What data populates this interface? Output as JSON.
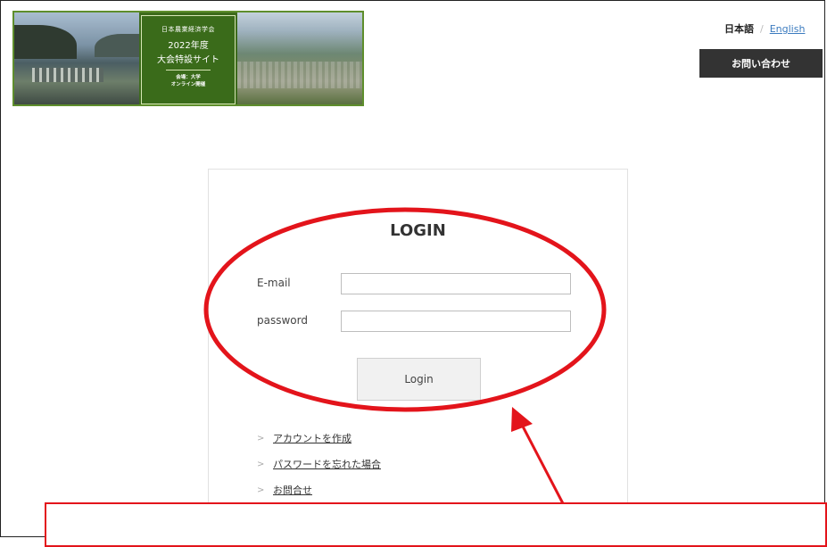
{
  "banner": {
    "society_name": "日本農業経済学会",
    "year": "2022年度",
    "site_title": "大会特設サイト",
    "host_line1": "会場：大学",
    "host_line2": "オンライン開催"
  },
  "header": {
    "lang_japanese": "日本語",
    "lang_separator": "/",
    "lang_english": "English",
    "contact_button": "お問い合わせ"
  },
  "login": {
    "heading": "LOGIN",
    "email_label": "E-mail",
    "email_value": "",
    "password_label": "password",
    "password_value": "",
    "submit_label": "Login",
    "links": [
      {
        "bullet": ">",
        "label": "アカウントを作成"
      },
      {
        "bullet": ">",
        "label": "パスワードを忘れた場合"
      },
      {
        "bullet": ">",
        "label": "お問合せ"
      }
    ]
  },
  "annotation": {
    "color": "#e3141b",
    "callout_text": ""
  }
}
